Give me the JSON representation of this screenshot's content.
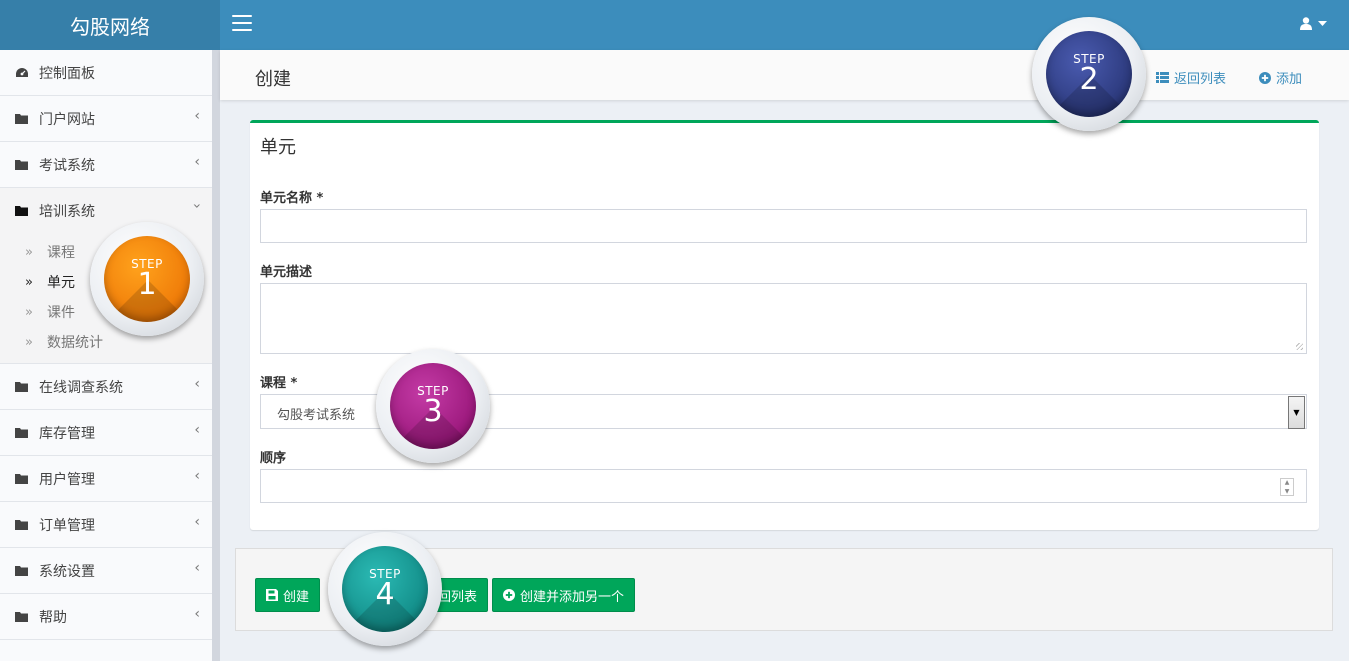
{
  "brand": "勾股网络",
  "sidebar": {
    "items": [
      {
        "label": "控制面板",
        "icon": "dashboard-icon"
      },
      {
        "label": "门户网站",
        "icon": "folder-icon"
      },
      {
        "label": "考试系统",
        "icon": "folder-icon"
      },
      {
        "label": "培训系统",
        "icon": "folder-open-icon"
      },
      {
        "label": "在线调查系统",
        "icon": "folder-icon"
      },
      {
        "label": "库存管理",
        "icon": "folder-icon"
      },
      {
        "label": "用户管理",
        "icon": "folder-icon"
      },
      {
        "label": "订单管理",
        "icon": "folder-icon"
      },
      {
        "label": "系统设置",
        "icon": "folder-icon"
      },
      {
        "label": "帮助",
        "icon": "folder-icon"
      }
    ],
    "submenu": [
      "课程",
      "单元",
      "课件",
      "数据统计"
    ],
    "active_sub": "单元"
  },
  "header": {
    "title": "创建",
    "back_list": "返回列表",
    "add": "添加"
  },
  "form": {
    "box_title": "单元",
    "name_label": "单元名称 *",
    "name_value": "",
    "desc_label": "单元描述",
    "desc_value": "",
    "course_label": "课程 *",
    "course_value": "勾股考试系统",
    "order_label": "顺序",
    "order_value": ""
  },
  "buttons": {
    "create": "创建",
    "create_return": "创建并返回列表",
    "create_return_visible": "回列表",
    "create_add": "创建并添加另一个"
  },
  "steps": [
    {
      "word": "STEP",
      "num": "1",
      "color": "#f07d00"
    },
    {
      "word": "STEP",
      "num": "2",
      "color": "#2a3a7e"
    },
    {
      "word": "STEP",
      "num": "3",
      "color": "#a0127e"
    },
    {
      "word": "STEP",
      "num": "4",
      "color": "#0a918d"
    }
  ],
  "colors": {
    "topbar": "#3c8dbc",
    "brand_bg": "#367fa9",
    "success": "#00a65a"
  }
}
